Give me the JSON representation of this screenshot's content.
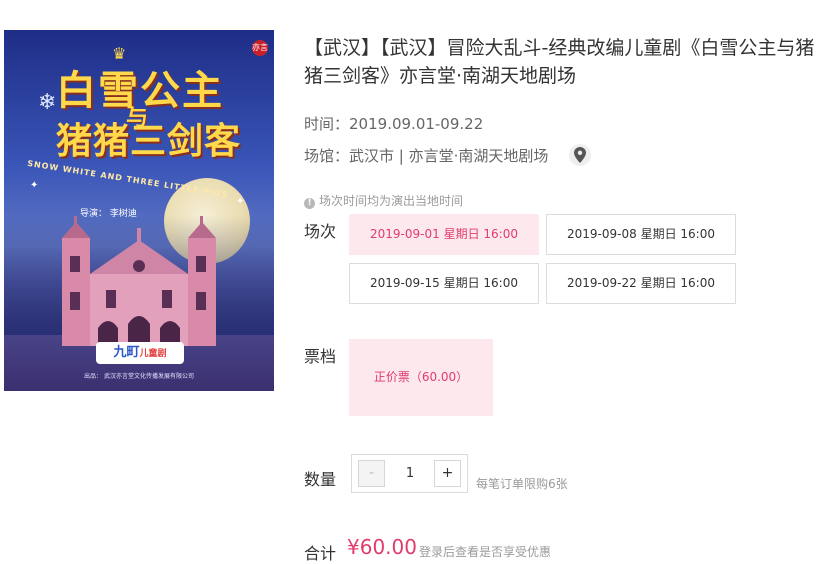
{
  "poster": {
    "title_line1": "白雪公主",
    "title_connector": "与",
    "title_line2": "猪猪三剑客",
    "subtitle_en": "SNOW WHITE AND THREE LITTLE PIGS",
    "director": "导演：  李树迪",
    "brand": "九町",
    "brand_suffix": "儿童剧",
    "credit": "出品：  武汉亦言堂文化传播发展有限公司",
    "seal": "亦言"
  },
  "event": {
    "title": "【武汉】【武汉】冒险大乱斗-经典改编儿童剧《白雪公主与猪猪三剑客》亦言堂·南湖天地剧场",
    "time_label": "时间：",
    "time_value": "2019.09.01-09.22",
    "venue_label": "场馆：",
    "venue_value": "武汉市 | 亦言堂·南湖天地剧场"
  },
  "notice": "场次时间均为演出当地时间",
  "sessions": {
    "label": "场次",
    "items": [
      {
        "text": "2019-09-01 星期日 16:00",
        "selected": true
      },
      {
        "text": "2019-09-08 星期日 16:00",
        "selected": false
      },
      {
        "text": "2019-09-15 星期日 16:00",
        "selected": false
      },
      {
        "text": "2019-09-22 星期日 16:00",
        "selected": false
      }
    ]
  },
  "tickets": {
    "label": "票档",
    "items": [
      {
        "text": "正价票（60.00）",
        "selected": true
      }
    ]
  },
  "quantity": {
    "label": "数量",
    "minus": "-",
    "value": "1",
    "plus": "+",
    "limit_note": "每笔订单限购6张"
  },
  "total": {
    "label": "合计",
    "price": "¥60.00",
    "note": "登录后查看是否享受优惠"
  },
  "colors": {
    "accent": "#e23c6b",
    "selected_bg": "#fde8ee",
    "border": "#dcdcdc",
    "muted_text": "#9a9a9a"
  },
  "icons": {
    "venue": "map-pin-icon",
    "notice": "info-icon"
  }
}
